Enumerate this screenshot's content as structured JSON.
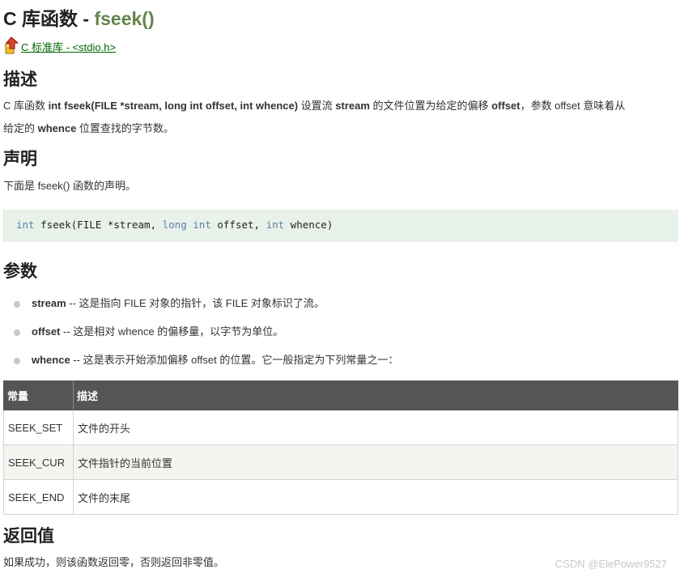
{
  "title": {
    "prefix": "C 库函数 - ",
    "function": "fseek()"
  },
  "back_link": {
    "label": "C 标准库 - <stdio.h>",
    "icon": "up-arrow-icon"
  },
  "sections": {
    "description": "描述",
    "declaration": "声明",
    "parameters": "参数",
    "return_value": "返回值"
  },
  "description": {
    "t1": "C 库函数 ",
    "b1": "int fseek(FILE *stream, long int offset, int whence)",
    "t2": " 设置流 ",
    "b2": "stream",
    "t3": " 的文件位置为给定的偏移 ",
    "b3": "offset",
    "t4": "，参数 offset 意味着从",
    "t5": "给定的 ",
    "b4": "whence",
    "t6": " 位置查找的字节数。"
  },
  "declaration_text": "下面是 fseek() 函数的声明。",
  "code": {
    "kw1": "int",
    "s1": " fseek(FILE *stream, ",
    "kw2": "long",
    "s2": " ",
    "kw3": "int",
    "s3": " offset, ",
    "kw4": "int",
    "s4": " whence)"
  },
  "params": [
    {
      "name": "stream",
      "desc": " -- 这是指向 FILE 对象的指针，该 FILE 对象标识了流。"
    },
    {
      "name": "offset",
      "desc": " -- 这是相对 whence 的偏移量，以字节为单位。"
    },
    {
      "name": "whence",
      "desc": " -- 这是表示开始添加偏移 offset 的位置。它一般指定为下列常量之一："
    }
  ],
  "table": {
    "headers": [
      "常量",
      "描述"
    ],
    "rows": [
      [
        "SEEK_SET",
        "文件的开头"
      ],
      [
        "SEEK_CUR",
        "文件指针的当前位置"
      ],
      [
        "SEEK_END",
        "文件的末尾"
      ]
    ]
  },
  "return_text": "如果成功，则该函数返回零，否则返回非零值。",
  "watermark": "CSDN @ElePower9527",
  "colors": {
    "function_name": "#64854c",
    "link": "#006600",
    "code_bg": "#e8f2ea",
    "table_header": "#555555"
  }
}
